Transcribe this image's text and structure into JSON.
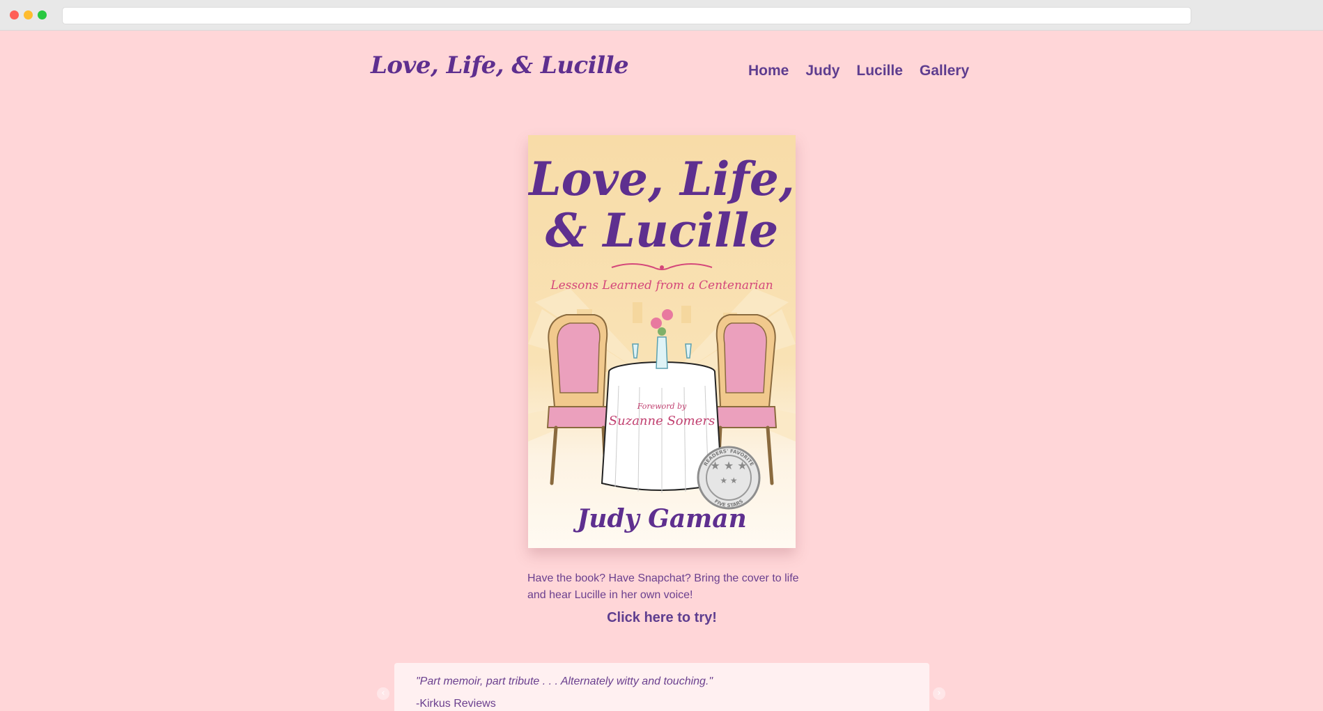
{
  "site": {
    "logo": "Love, Life, & Lucille"
  },
  "nav": {
    "items": [
      "Home",
      "Judy",
      "Lucille",
      "Gallery"
    ]
  },
  "cover": {
    "title_line1": "Love, Life,",
    "title_line2": "& Lucille",
    "subtitle": "Lessons Learned from a Centenarian",
    "foreword_label": "Foreword by",
    "foreword_name": "Suzanne Somers",
    "author": "Judy Gaman",
    "seal_top": "READERS' FAVORITE",
    "seal_bottom": "FIVE STARS"
  },
  "promo": {
    "blurb": "Have the book? Have Snapchat? Bring the cover to life and hear Lucille in her own voice!",
    "cta": "Click here to try!"
  },
  "testimonial": {
    "quote": "\"Part memoir, part tribute . . . Alternately witty and touching.\"",
    "source": "-Kirkus Reviews",
    "prev_icon": "‹",
    "next_icon": "›"
  },
  "colors": {
    "background": "#ffd6d8",
    "brand_purple": "#5e2f8f",
    "accent_pink": "#d4477a"
  }
}
